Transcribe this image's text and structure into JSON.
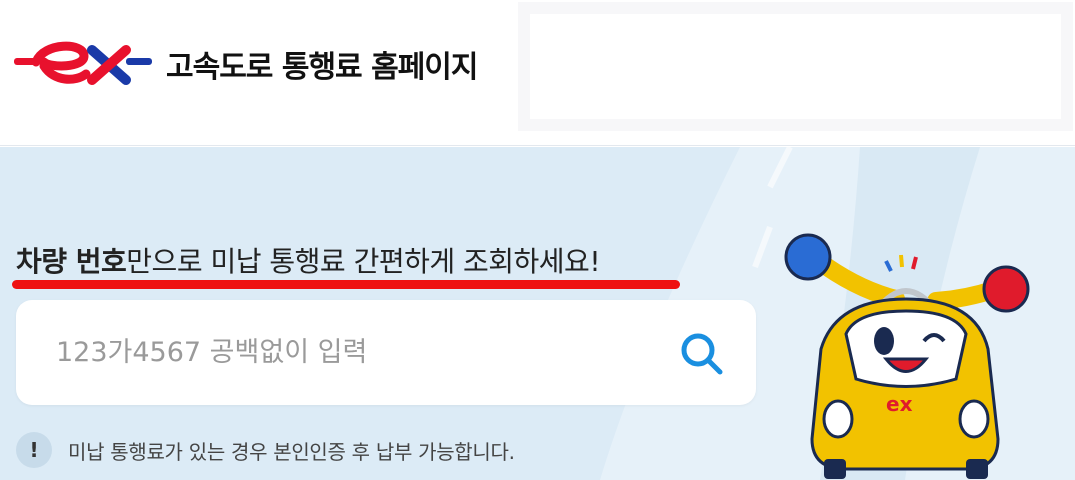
{
  "header": {
    "logo_name": "ex-logo",
    "site_title": "고속도로 통행료 홈페이지"
  },
  "hero": {
    "headline_bold": "차량 번호",
    "headline_rest": "만으로 미납 통행료 간편하게 조회하세요!",
    "search": {
      "placeholder": "123가4567 공백없이 입력",
      "value": ""
    },
    "notice_icon_text": "!",
    "notice_text": "미납 통행료가 있는 경우 본인인증 후 납부 가능합니다.",
    "mascot_logo_text": "ex"
  },
  "colors": {
    "brand_red": "#e8112d",
    "brand_blue": "#1a3aa8",
    "hero_bg": "#dcebf6",
    "underline": "#ee1111",
    "search_icon": "#1a8fe0"
  }
}
